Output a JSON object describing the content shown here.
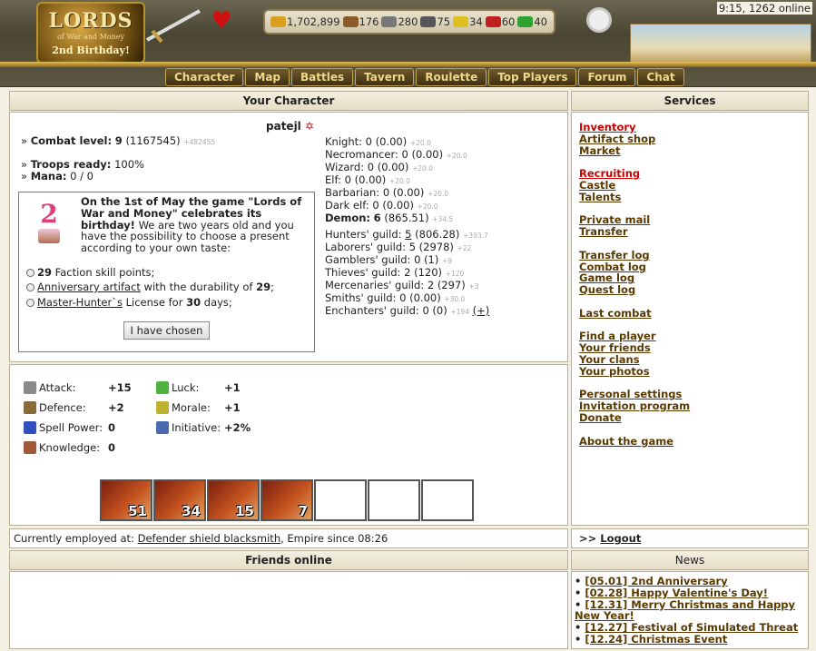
{
  "header": {
    "logo": {
      "title": "LORDS",
      "subtitle": "of War and Money",
      "birthday": "2nd Birthday!"
    },
    "resources": [
      {
        "icon": "gold-icon",
        "value": "1,702,899",
        "color": "#d9a020"
      },
      {
        "icon": "wood-icon",
        "value": "176",
        "color": "#8a5a2a"
      },
      {
        "icon": "ore-icon",
        "value": "280",
        "color": "#777777"
      },
      {
        "icon": "mercury-icon",
        "value": "75",
        "color": "#555555"
      },
      {
        "icon": "sulfur-icon",
        "value": "34",
        "color": "#e0c020"
      },
      {
        "icon": "crystal-icon",
        "value": "60",
        "color": "#c02020"
      },
      {
        "icon": "gems-icon",
        "value": "40",
        "color": "#30a030"
      }
    ],
    "time_online": "9:15, 1262 online",
    "nav": [
      "Character",
      "Map",
      "Battles",
      "Tavern",
      "Roulette",
      "Top Players",
      "Forum",
      "Chat"
    ]
  },
  "character": {
    "panel_title": "Your Character",
    "name": "patejl",
    "combat_label": "Combat level:",
    "combat_level": "9",
    "combat_exp": "(1167545)",
    "combat_next": "+482455",
    "troops_label": "Troops ready:",
    "troops_value": "100%",
    "mana_label": "Mana:",
    "mana_value": "0 / 0",
    "factions": [
      {
        "name": "Knight:",
        "value": "0 (0.00)",
        "plus": "+20.0"
      },
      {
        "name": "Necromancer:",
        "value": "0 (0.00)",
        "plus": "+20.0"
      },
      {
        "name": "Wizard:",
        "value": "0 (0.00)",
        "plus": "+20.0"
      },
      {
        "name": "Elf:",
        "value": "0 (0.00)",
        "plus": "+20.0"
      },
      {
        "name": "Barbarian:",
        "value": "0 (0.00)",
        "plus": "+20.0"
      },
      {
        "name": "Dark elf:",
        "value": "0 (0.00)",
        "plus": "+20.0"
      },
      {
        "name": "Demon:",
        "value": "6",
        "value2": "(865.51)",
        "plus": "+34.5"
      }
    ],
    "guilds": [
      {
        "name": "Hunters' guild:",
        "level": "5",
        "value": "(806.28)",
        "plus": "+393.7"
      },
      {
        "name": "Laborers' guild:",
        "level": "5",
        "value": "(2978)",
        "plus": "+22"
      },
      {
        "name": "Gamblers' guild:",
        "level": "0",
        "value": "(1)",
        "plus": "+9"
      },
      {
        "name": "Thieves' guild:",
        "level": "2",
        "value": "(120)",
        "plus": "+120"
      },
      {
        "name": "Mercenaries' guild:",
        "level": "2",
        "value": "(297)",
        "plus": "+3"
      },
      {
        "name": "Smiths' guild:",
        "level": "0",
        "value": "(0.00)",
        "plus": "+30.0"
      },
      {
        "name": "Enchanters' guild:",
        "level": "0",
        "value": "(0)",
        "plus": "+194",
        "extra": "(+)"
      }
    ]
  },
  "present": {
    "text_bold": "On the 1st of May the game \"Lords of War and Money\" celebrates its birthday!",
    "text": " We are two years old and you have the possibility to choose a present according to your own taste:",
    "options": [
      {
        "bold": "29",
        "text": " Faction skill points;"
      },
      {
        "link": "Anniversary artifact",
        "text": " with the durability of ",
        "bold": "29",
        "tail": ";"
      },
      {
        "link": "Master-Hunter`s",
        "text": " License for ",
        "bold": "30",
        "tail": " days;"
      }
    ],
    "button": "I have chosen"
  },
  "stats": [
    {
      "icon": "attack-icon",
      "label": "Attack:",
      "value": "+15",
      "color": "#8a8a8a"
    },
    {
      "icon": "defence-icon",
      "label": "Defence:",
      "value": "+2",
      "color": "#8a6a3a"
    },
    {
      "icon": "spell-power-icon",
      "label": "Spell Power:",
      "value": "0",
      "color": "#3050c0"
    },
    {
      "icon": "knowledge-icon",
      "label": "Knowledge:",
      "value": "0",
      "color": "#a05a3a"
    },
    {
      "icon": "luck-icon",
      "label": "Luck:",
      "value": "+1",
      "color": "#50b040"
    },
    {
      "icon": "morale-icon",
      "label": "Morale:",
      "value": "+1",
      "color": "#c0b030"
    },
    {
      "icon": "initiative-icon",
      "label": "Initiative:",
      "value": "+2%",
      "color": "#4a6ab0"
    }
  ],
  "army": [
    "51",
    "34",
    "15",
    "7",
    "",
    "",
    ""
  ],
  "employment": {
    "label": "Currently employed at:",
    "link": "Defender shield blacksmith",
    "tail": ", Empire since 08:26"
  },
  "friends": {
    "title": "Friends online"
  },
  "services": {
    "title": "Services",
    "groups": [
      [
        {
          "label": "Inventory",
          "red": true
        },
        {
          "label": "Artifact shop"
        },
        {
          "label": "Market"
        }
      ],
      [
        {
          "label": "Recruiting",
          "red": true
        },
        {
          "label": "Castle"
        },
        {
          "label": "Talents"
        }
      ],
      [
        {
          "label": "Private mail"
        },
        {
          "label": "Transfer"
        }
      ],
      [
        {
          "label": "Transfer log"
        },
        {
          "label": "Combat log"
        },
        {
          "label": "Game log"
        },
        {
          "label": "Quest log"
        }
      ],
      [
        {
          "label": "Last combat"
        }
      ],
      [
        {
          "label": "Find a player"
        },
        {
          "label": "Your friends"
        },
        {
          "label": "Your clans"
        },
        {
          "label": "Your photos"
        }
      ],
      [
        {
          "label": "Personal settings"
        },
        {
          "label": "Invitation program"
        },
        {
          "label": "Donate"
        }
      ],
      [
        {
          "label": "About the game"
        }
      ]
    ],
    "logout_prefix": ">>",
    "logout": "Logout"
  },
  "news": {
    "title": "News",
    "items": [
      "[05.01] 2nd Anniversary",
      "[02.28] Happy Valentine's Day!",
      "[12.31] Merry Christmas and Happy New Year!",
      "[12.27] Festival of Simulated Threat",
      "[12.24] Christmas Event"
    ]
  }
}
